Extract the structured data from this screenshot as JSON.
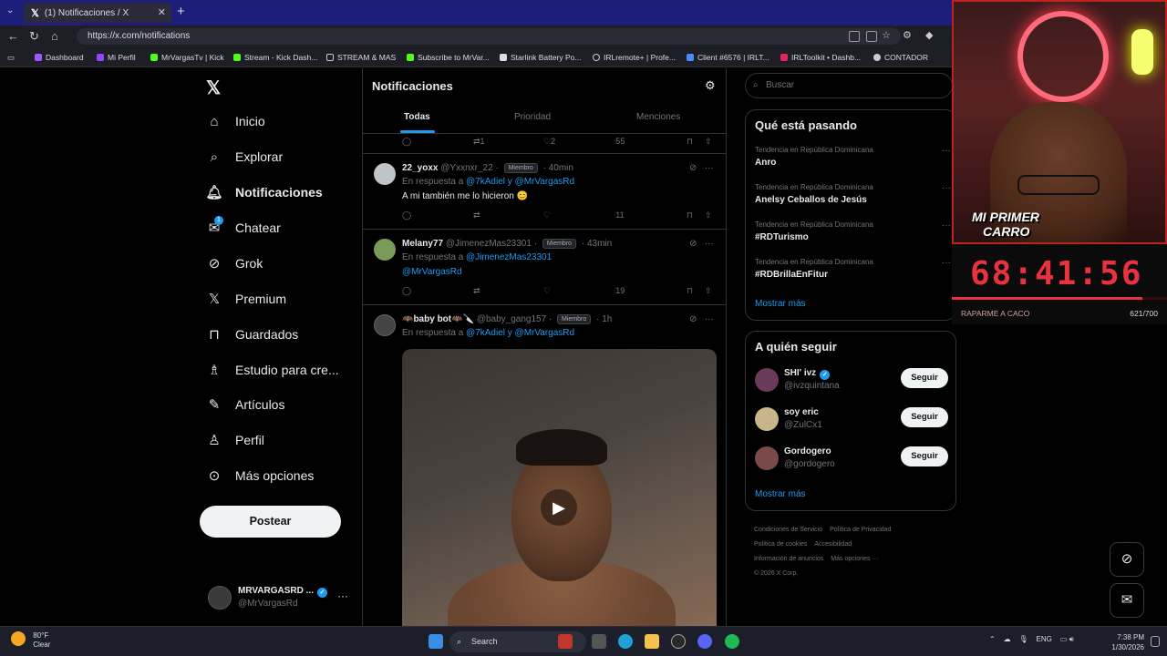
{
  "browser": {
    "tab_title": "(1) Notificaciones / X",
    "url": "https://x.com/notifications",
    "bookmarks": [
      "Dashboard",
      "Mi Perfil",
      "MrVargasTv | Kick",
      "Stream - Kick Dash...",
      "STREAM & MAS",
      "Subscribe to MrVar...",
      "Starlink Battery Po...",
      "IRLremote+ | Profe...",
      "Client #6576 | IRLT...",
      "IRLToolkit • Dashb...",
      "CONTADOR"
    ]
  },
  "nav": {
    "items": [
      {
        "label": "Inicio",
        "icon": "home-icon"
      },
      {
        "label": "Explorar",
        "icon": "search-icon"
      },
      {
        "label": "Notificaciones",
        "icon": "bell-icon"
      },
      {
        "label": "Chatear",
        "icon": "mail-icon",
        "badge": "1"
      },
      {
        "label": "Grok",
        "icon": "grok-icon"
      },
      {
        "label": "Premium",
        "icon": "x-icon"
      },
      {
        "label": "Guardados",
        "icon": "bookmark-icon"
      },
      {
        "label": "Estudio para cre...",
        "icon": "studio-icon"
      },
      {
        "label": "Artículos",
        "icon": "article-icon"
      },
      {
        "label": "Perfil",
        "icon": "person-icon"
      },
      {
        "label": "Más opciones",
        "icon": "more-icon"
      }
    ],
    "post_label": "Postear",
    "account": {
      "name": "MRVARGASRD ...",
      "handle": "@MrVargasRd"
    }
  },
  "main": {
    "title": "Notificaciones",
    "tabs": [
      "Todas",
      "Prioridad",
      "Menciones"
    ],
    "top_actions": {
      "retweets": "1",
      "likes": "2",
      "views": "55"
    },
    "tweets": [
      {
        "name": "22_yoxx",
        "handle": "@Yxxnxr_22",
        "badge": "Miembro",
        "time": "40min",
        "reply_prefix": "En respuesta a",
        "reply_mentions": "@7kAdiel y @MrVargasRd",
        "text": "A mi también me lo hicieron 😊",
        "views": "11"
      },
      {
        "name": "Melany77",
        "handle": "@JimenezMas23301",
        "badge": "Miembro",
        "time": "43min",
        "reply_prefix": "En respuesta a",
        "reply_mentions": "@JimenezMas23301",
        "reply_mentions_2": "@MrVargasRd",
        "views": "19"
      },
      {
        "name": "🦇baby bot🦇🔪",
        "handle": "@baby_gang157",
        "badge": "Miembro",
        "time": "1h",
        "reply_prefix": "En respuesta a",
        "reply_mentions": "@7kAdiel y @MrVargasRd"
      }
    ]
  },
  "right": {
    "search_placeholder": "Buscar",
    "trends_title": "Qué está pasando",
    "trends": [
      {
        "context": "Tendencia en República Dominicana",
        "topic": "Anro"
      },
      {
        "context": "Tendencia en República Dominicana",
        "topic": "Anelsy Ceballos de Jesús"
      },
      {
        "context": "Tendencia en República Dominicana",
        "topic": "#RDTurismo"
      },
      {
        "context": "Tendencia en República Dominicana",
        "topic": "#RDBrillaEnFitur"
      }
    ],
    "show_more": "Mostrar más",
    "follow_title": "A quién seguir",
    "follow": [
      {
        "name": "SHI' ivz",
        "handle": "@ivzquintana",
        "verified": true
      },
      {
        "name": "soy eric",
        "handle": "@ZulCx1"
      },
      {
        "name": "Gordogero",
        "handle": "@gordogero"
      }
    ],
    "follow_label": "Seguir",
    "footer": [
      "Condiciones de Servicio",
      "Política de Privacidad",
      "Política de cookies",
      "Accesibilidad",
      "Información de anuncios",
      "Más opciones ···",
      "© 2026 X Corp."
    ]
  },
  "stream": {
    "logo_line1": "MI PRIMER",
    "logo_line2": "CARRO",
    "timer": "68:41:56",
    "progress_label": "RAPARME A CACO",
    "progress_count": "621/700",
    "progress_fraction": 0.887
  },
  "taskbar": {
    "temp": "80°F",
    "weather": "Clear",
    "search": "Search",
    "lang": "ENG",
    "time": "7:38 PM",
    "date": "1/30/2026"
  },
  "colors": {
    "accent": "#1d9bf0",
    "timer": "#e8323f",
    "taskbar": "#1c1f2a"
  }
}
